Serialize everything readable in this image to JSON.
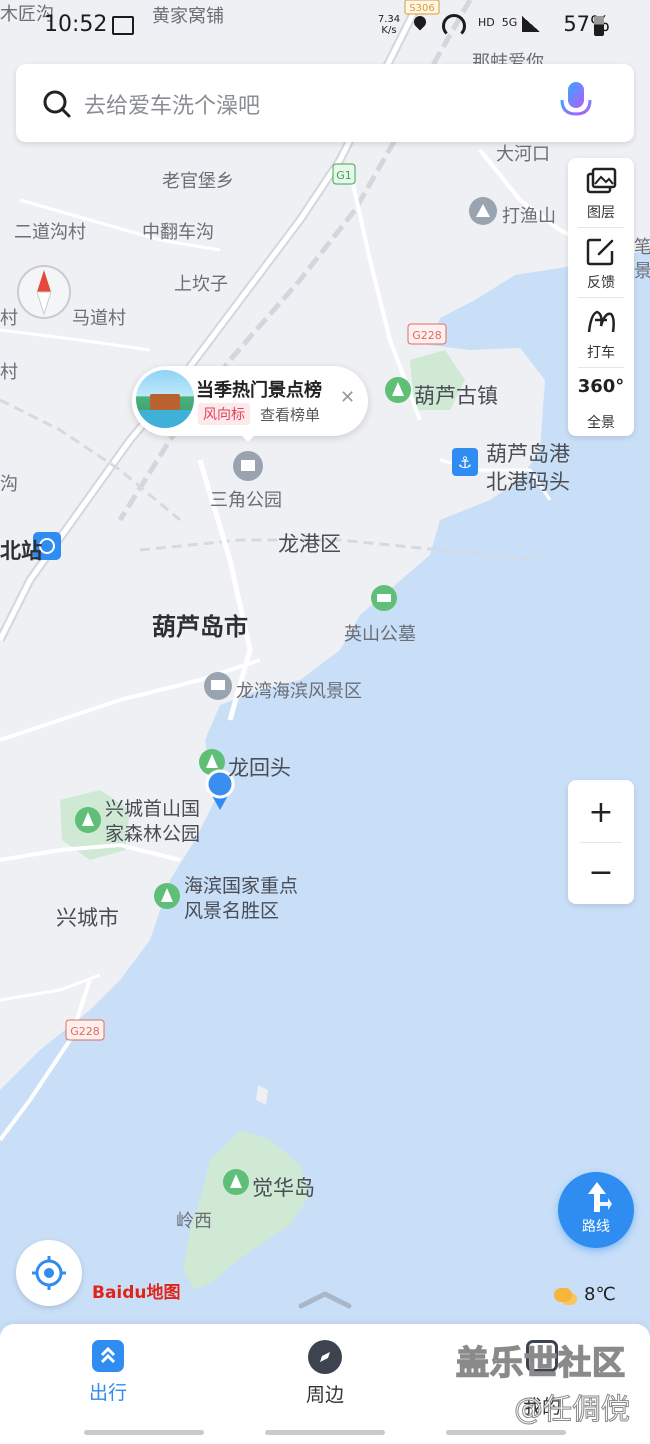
{
  "status_bar": {
    "time": "10:52",
    "net_speed": "7.34 K/s",
    "labels": "HD  5G",
    "battery": "57%"
  },
  "search": {
    "placeholder": "去给爱车洗个澡吧"
  },
  "map_tools": {
    "layers": "图层",
    "feedback": "反馈",
    "taxi": "打车",
    "panorama": "全景",
    "panorama_badge": "360°"
  },
  "popup": {
    "title": "当季热门景点榜",
    "tag": "风向标",
    "action": "查看榜单"
  },
  "place_labels": {
    "top_left_cut": "木匠沟",
    "huangjia": "黄家窝铺",
    "top_right_cut": "那蚌爱你",
    "road_s306": "S306",
    "dahekou": "大河口",
    "laoguanpu": "老官堡乡",
    "road_g1": "G1",
    "dayucun": "打渔山",
    "erdaogou": "二道沟村",
    "zhongfan": "中翻车沟",
    "shangkanzi": "上坎子",
    "madao": "马道村",
    "road_g228_top": "G228",
    "huludao_town": "葫芦古镇",
    "port": "葫芦岛港\n北港码头",
    "sanjiao": "三角公园",
    "station_cut": "北站",
    "longgang": "龙港区",
    "huludao_city": "葫芦岛市",
    "yingshan": "英山公墓",
    "longwan": "龙湾海滨风景区",
    "longhuitou": "龙回头",
    "forest_park": "兴城首山国\n家森林公园",
    "scenic": "海滨国家重点\n风景名胜区",
    "xingcheng": "兴城市",
    "road_g228_bottom": "G228",
    "juehuadao": "觉华岛",
    "lingxi": "岭西",
    "right_edge_cut": "笔\n景",
    "village_cut1": "村",
    "village_cut2": "村",
    "village_cut3": "沟"
  },
  "zoom": {
    "plus": "+",
    "minus": "−"
  },
  "route_button": "路线",
  "logo": "Baidu地图",
  "weather": {
    "temp": "8℃",
    "icon": "partly-cloudy-icon"
  },
  "bottom_nav": {
    "items": [
      {
        "label": "出行",
        "icon": "travel-icon",
        "active": true
      },
      {
        "label": "周边",
        "icon": "compass-icon",
        "active": false
      },
      {
        "label": "我的",
        "icon": "profile-icon",
        "active": false
      }
    ]
  },
  "watermark": {
    "line1": "盖乐世社区",
    "line2": "@任倜傥"
  },
  "colors": {
    "land": "#eef0f4",
    "sea": "#c9dff8",
    "accent": "#2f8cf0",
    "park": "#cfe9d5"
  }
}
